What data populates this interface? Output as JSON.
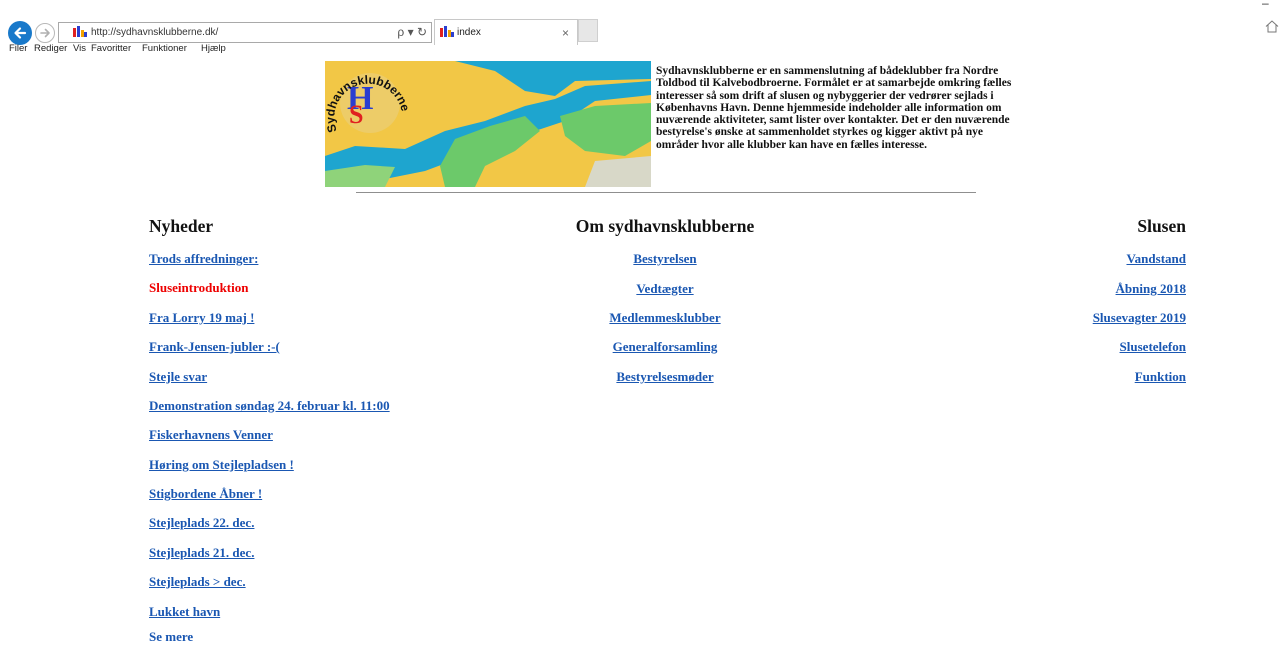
{
  "browser": {
    "url": "http://sydhavnsklubberne.dk/",
    "tab_title": "index",
    "tab_close": "×",
    "search_refresh": "ρ ▾ ↻",
    "menu": [
      "Filer",
      "Rediger",
      "Vis",
      "Favoritter",
      "Funktioner",
      "Hjælp"
    ],
    "minimize": "–"
  },
  "hero": {
    "logo_text": "Sydhavnsklubberne",
    "colors": {
      "water": "#1ea5cf",
      "land": "#f2c746",
      "park": "#6cc96a",
      "logo_h": "#2a3ed0",
      "logo_s": "#e02020"
    }
  },
  "intro": "Sydhavnsklubberne er en sammenslutning af bådeklubber fra Nordre Toldbod til Kalvebodbroerne. Formålet er at samarbejde omkring fælles interesser så som drift af slusen og nybyggerier der vedrører sejlads i Københavns Havn. Denne hjemmeside indeholder alle information om nuværende aktiviteter, samt lister over kontakter. Det er den nuværende bestyrelse's ønske at sammenholdet styrkes og kigger aktivt på nye områder hvor alle klubber kan have en fælles interesse.",
  "news": {
    "heading": "Nyheder",
    "items": [
      "Trods affredninger:",
      "Sluseintroduktion",
      "Fra Lorry 19 maj !",
      "Frank-Jensen-jubler :-(",
      "Stejle svar",
      "Demonstration søndag 24. februar kl. 11:00",
      "Fiskerhavnens Venner",
      "Høring om Stejlepladsen !",
      "Stigbordene Åbner !",
      "Stejleplads 22. dec.",
      "Stejleplads 21. dec.",
      "Stejleplads > dec.",
      "Lukket havn",
      "Se mere"
    ]
  },
  "about": {
    "heading": "Om sydhavnsklubberne",
    "items": [
      "Bestyrelsen",
      "Vedtægter",
      "Medlemmesklubber",
      "Generalforsamling",
      "Bestyrelsesmøder"
    ]
  },
  "lock": {
    "heading": "Slusen",
    "items": [
      "Vandstand",
      "Åbning 2018",
      "Slusevagter 2019",
      "Slusetelefon",
      "Funktion"
    ]
  },
  "colors": {
    "link": "#1a57b2",
    "highlight": "#ee0000"
  }
}
